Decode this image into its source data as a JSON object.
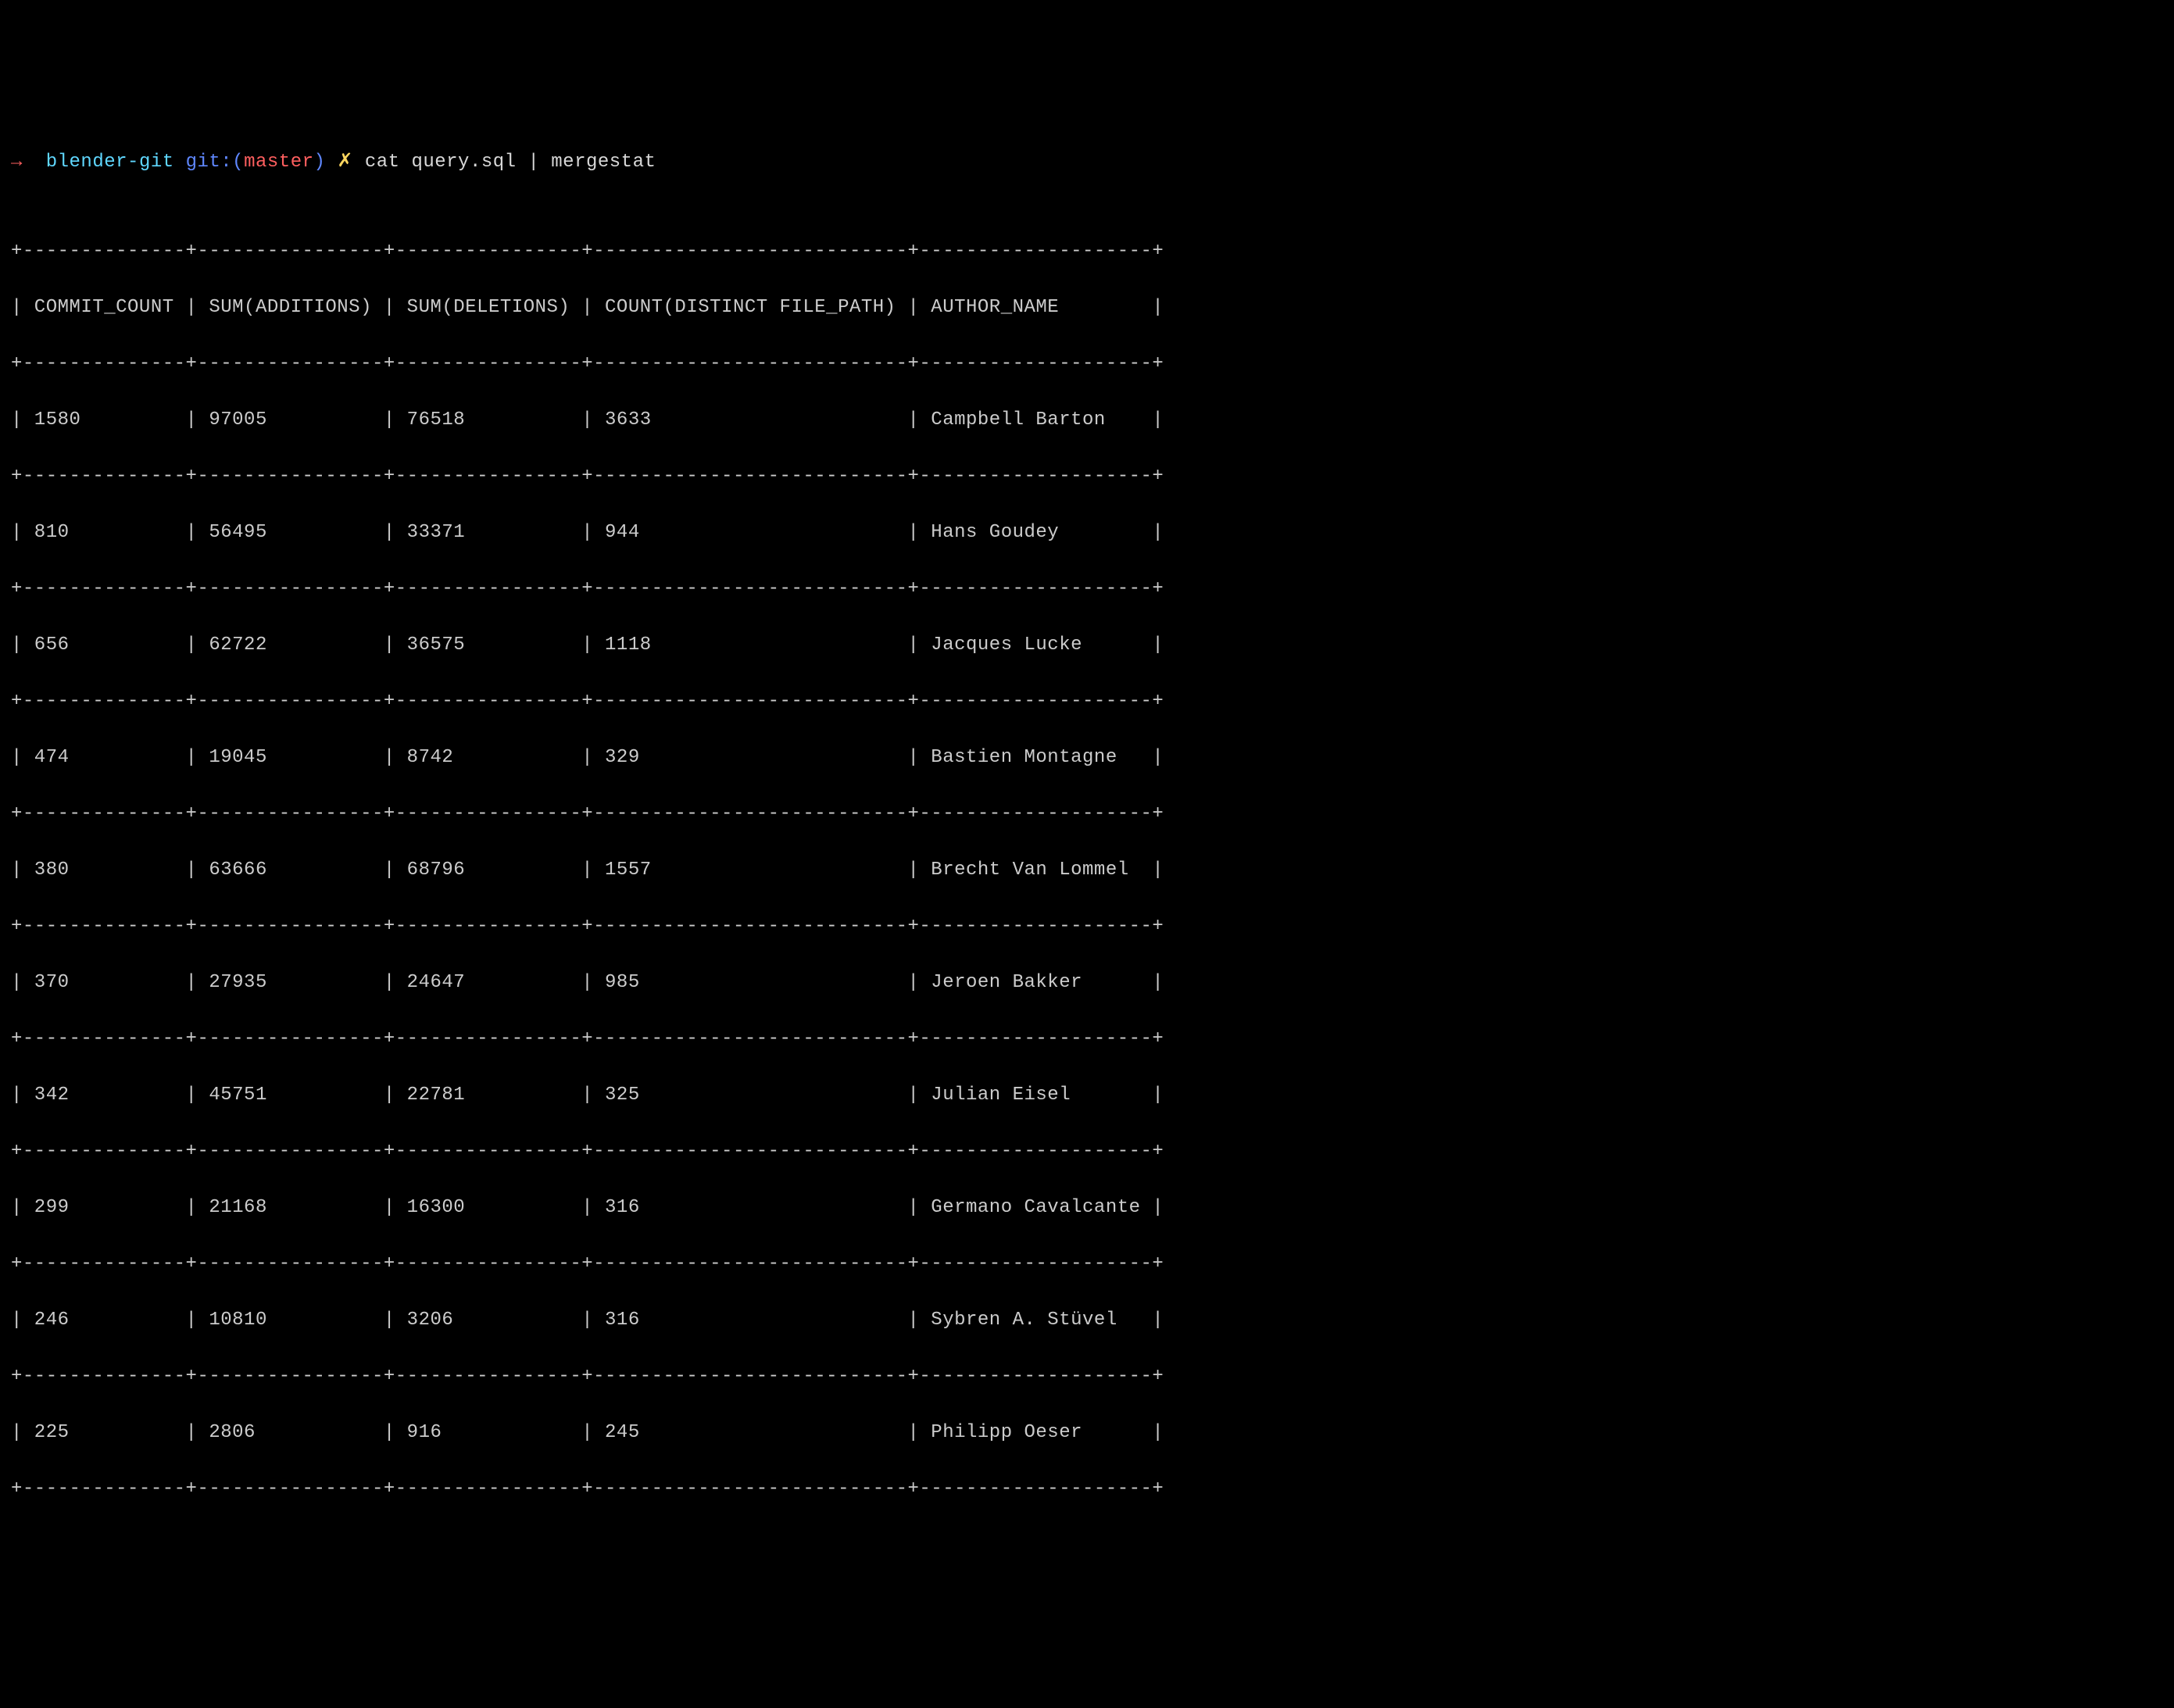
{
  "prompt": {
    "arrow": "→",
    "dir": "blender-git",
    "git_prefix": "git:(",
    "branch": "master",
    "git_suffix": ")",
    "cross": "✗",
    "command": "cat query.sql | mergestat"
  },
  "table": {
    "separator": "+--------------+----------------+----------------+---------------------------+--------------------+",
    "header": "| COMMIT_COUNT | SUM(ADDITIONS) | SUM(DELETIONS) | COUNT(DISTINCT FILE_PATH) | AUTHOR_NAME        |",
    "rows": [
      "| 1580         | 97005          | 76518          | 3633                      | Campbell Barton    |",
      "| 810          | 56495          | 33371          | 944                       | Hans Goudey        |",
      "| 656          | 62722          | 36575          | 1118                      | Jacques Lucke      |",
      "| 474          | 19045          | 8742           | 329                       | Bastien Montagne   |",
      "| 380          | 63666          | 68796          | 1557                      | Brecht Van Lommel  |",
      "| 370          | 27935          | 24647          | 985                       | Jeroen Bakker      |",
      "| 342          | 45751          | 22781          | 325                       | Julian Eisel       |",
      "| 299          | 21168          | 16300          | 316                       | Germano Cavalcante |",
      "| 246          | 10810          | 3206           | 316                       | Sybren A. Stüvel   |",
      "| 225          | 2806           | 916            | 245                       | Philipp Oeser      |"
    ]
  },
  "chart_data": {
    "type": "table",
    "columns": [
      "COMMIT_COUNT",
      "SUM(ADDITIONS)",
      "SUM(DELETIONS)",
      "COUNT(DISTINCT FILE_PATH)",
      "AUTHOR_NAME"
    ],
    "data": [
      {
        "COMMIT_COUNT": 1580,
        "SUM(ADDITIONS)": 97005,
        "SUM(DELETIONS)": 76518,
        "COUNT(DISTINCT FILE_PATH)": 3633,
        "AUTHOR_NAME": "Campbell Barton"
      },
      {
        "COMMIT_COUNT": 810,
        "SUM(ADDITIONS)": 56495,
        "SUM(DELETIONS)": 33371,
        "COUNT(DISTINCT FILE_PATH)": 944,
        "AUTHOR_NAME": "Hans Goudey"
      },
      {
        "COMMIT_COUNT": 656,
        "SUM(ADDITIONS)": 62722,
        "SUM(DELETIONS)": 36575,
        "COUNT(DISTINCT FILE_PATH)": 1118,
        "AUTHOR_NAME": "Jacques Lucke"
      },
      {
        "COMMIT_COUNT": 474,
        "SUM(ADDITIONS)": 19045,
        "SUM(DELETIONS)": 8742,
        "COUNT(DISTINCT FILE_PATH)": 329,
        "AUTHOR_NAME": "Bastien Montagne"
      },
      {
        "COMMIT_COUNT": 380,
        "SUM(ADDITIONS)": 63666,
        "SUM(DELETIONS)": 68796,
        "COUNT(DISTINCT FILE_PATH)": 1557,
        "AUTHOR_NAME": "Brecht Van Lommel"
      },
      {
        "COMMIT_COUNT": 370,
        "SUM(ADDITIONS)": 27935,
        "SUM(DELETIONS)": 24647,
        "COUNT(DISTINCT FILE_PATH)": 985,
        "AUTHOR_NAME": "Jeroen Bakker"
      },
      {
        "COMMIT_COUNT": 342,
        "SUM(ADDITIONS)": 45751,
        "SUM(DELETIONS)": 22781,
        "COUNT(DISTINCT FILE_PATH)": 325,
        "AUTHOR_NAME": "Julian Eisel"
      },
      {
        "COMMIT_COUNT": 299,
        "SUM(ADDITIONS)": 21168,
        "SUM(DELETIONS)": 16300,
        "COUNT(DISTINCT FILE_PATH)": 316,
        "AUTHOR_NAME": "Germano Cavalcante"
      },
      {
        "COMMIT_COUNT": 246,
        "SUM(ADDITIONS)": 10810,
        "SUM(DELETIONS)": 3206,
        "COUNT(DISTINCT FILE_PATH)": 316,
        "AUTHOR_NAME": "Sybren A. Stüvel"
      },
      {
        "COMMIT_COUNT": 225,
        "SUM(ADDITIONS)": 2806,
        "SUM(DELETIONS)": 916,
        "COUNT(DISTINCT FILE_PATH)": 245,
        "AUTHOR_NAME": "Philipp Oeser"
      }
    ]
  }
}
